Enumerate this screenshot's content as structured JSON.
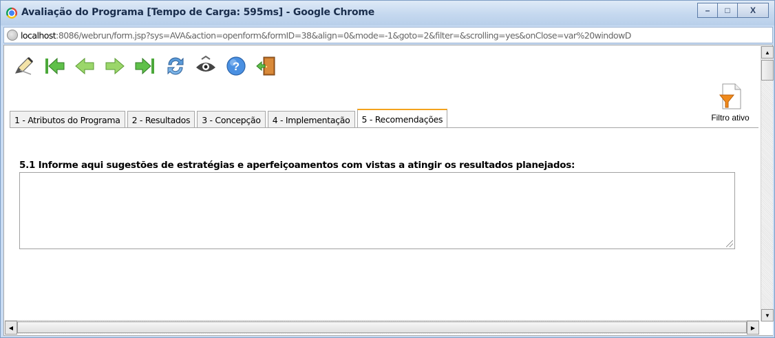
{
  "window": {
    "title": "Avaliação do Programa [Tempo de Carga: 595ms] - Google Chrome",
    "controls": {
      "minimize": "–",
      "maximize": "□",
      "close": "X"
    }
  },
  "address_bar": {
    "host": "localhost",
    "rest": ":8086/webrun/form.jsp?sys=AVA&action=openform&formID=38&align=0&mode=-1&goto=2&filter=&scrolling=yes&onClose=var%20windowD"
  },
  "toolbar": {
    "icons": [
      "edit-pencil-icon",
      "first-record-icon",
      "previous-record-icon",
      "next-record-icon",
      "last-record-icon",
      "refresh-icon",
      "search-icon",
      "help-icon",
      "exit-door-icon"
    ]
  },
  "filter": {
    "label": "Filtro ativo"
  },
  "tabs": [
    {
      "label": "1 - Atributos do Programa"
    },
    {
      "label": "2 - Resultados"
    },
    {
      "label": "3 - Concepção"
    },
    {
      "label": "4 - Implementação"
    },
    {
      "label": "5 - Recomendações"
    }
  ],
  "form": {
    "question": "5.1 Informe aqui sugestões de estratégias e aperfeiçoamentos com vistas a atingir os resultados planejados:",
    "answer_value": ""
  },
  "colors": {
    "active_tab_accent": "#f4a21c",
    "title_bar": "#c5d8ef"
  }
}
